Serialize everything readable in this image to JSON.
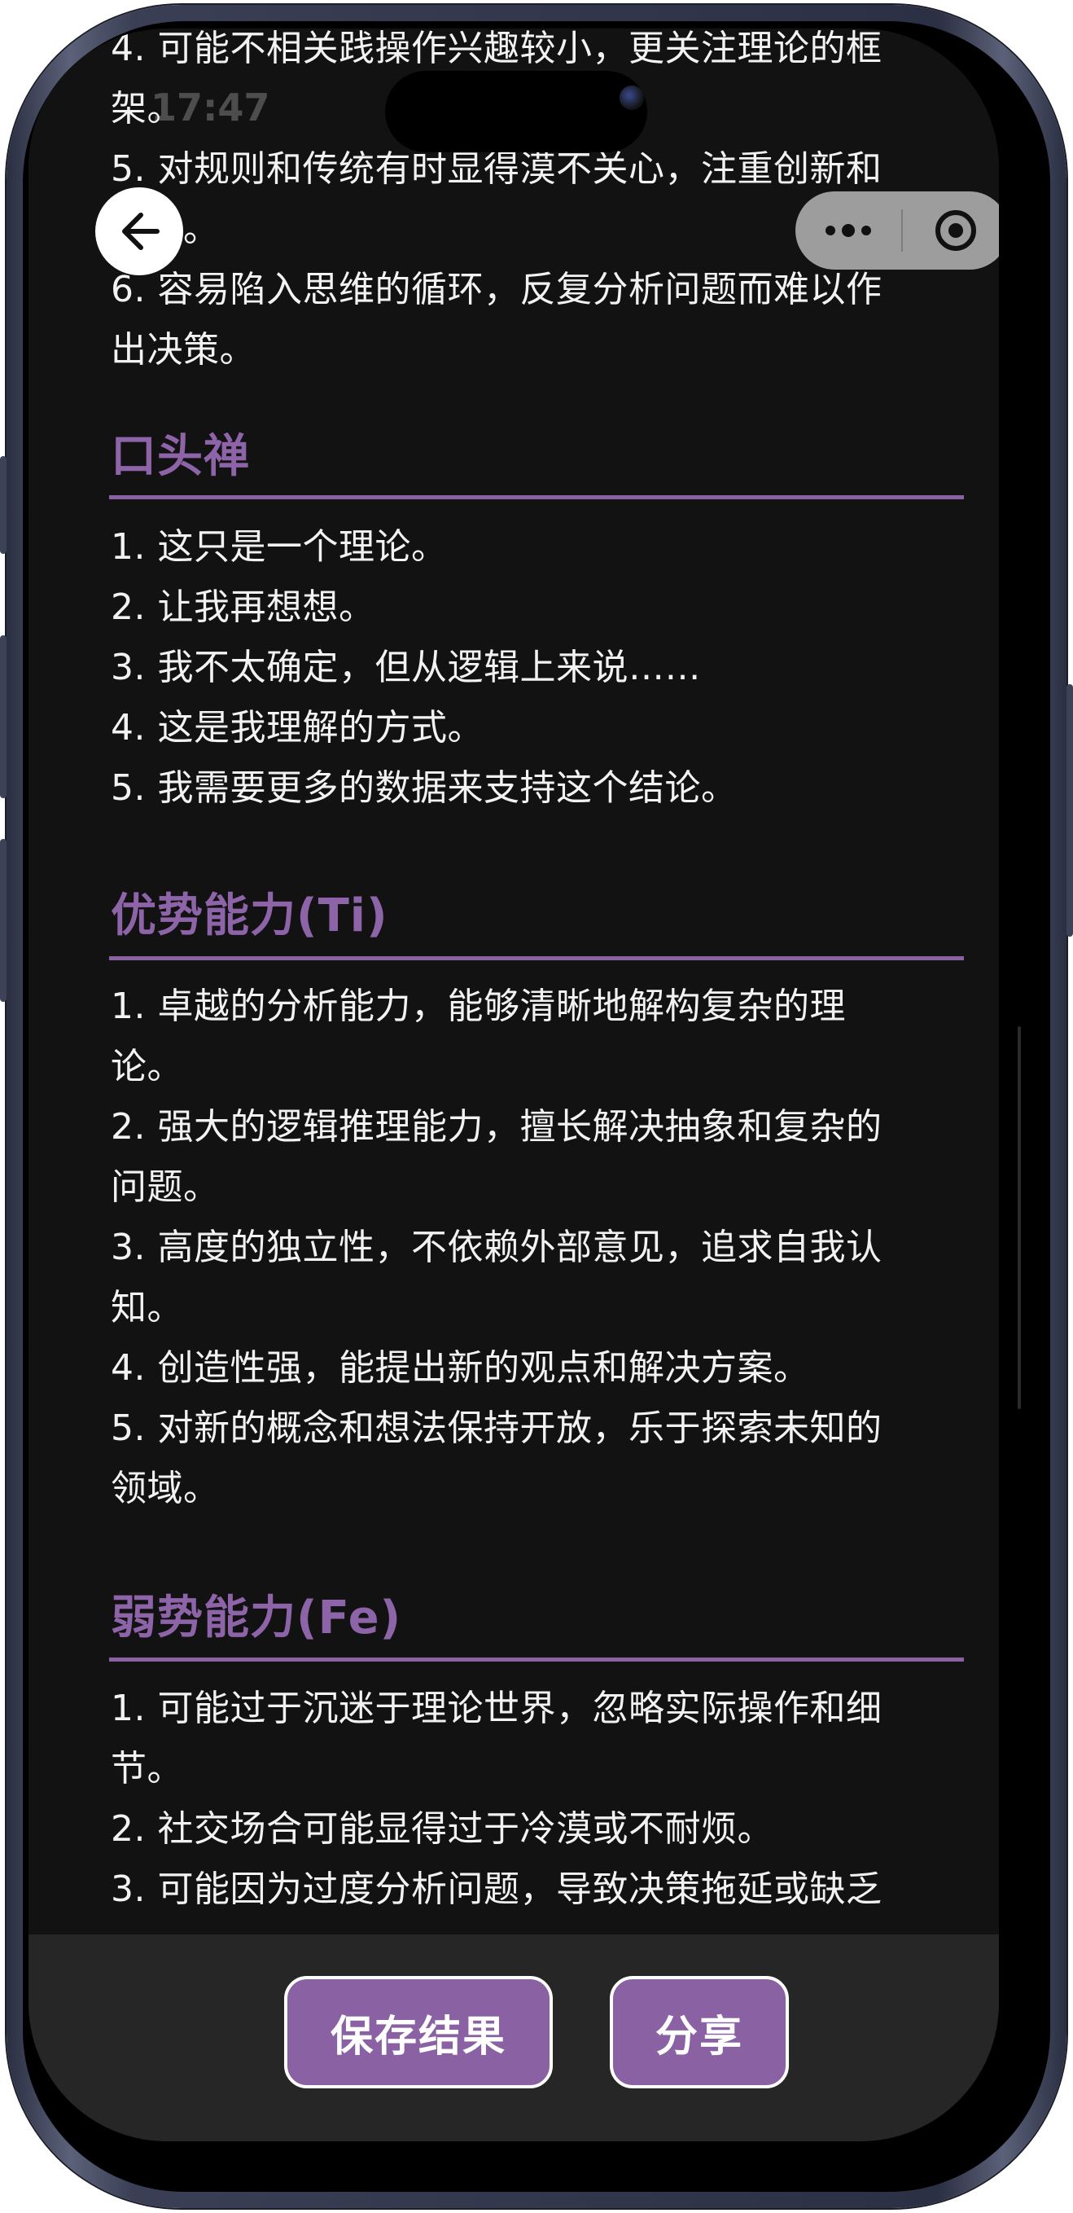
{
  "status": {
    "time": "17:47"
  },
  "top_partial_lines": [
    "4. 可能不相关践操作兴趣较小，更关注理论的框",
    "架。",
    "5. 对规则和传统有时显得漠不关心，注重创新和",
    "自由。",
    "6. 容易陷入思维的循环，反复分析问题而难以作",
    "出决策。"
  ],
  "sections": [
    {
      "title": "口头禅",
      "lines": [
        "1. 这只是一个理论。",
        "2. 让我再想想。",
        "3. 我不太确定，但从逻辑上来说……",
        "4. 这是我理解的方式。",
        "5. 我需要更多的数据来支持这个结论。"
      ]
    },
    {
      "title": "优势能力(Ti)",
      "lines": [
        "1. 卓越的分析能力，能够清晰地解构复杂的理",
        "论。",
        "2. 强大的逻辑推理能力，擅长解决抽象和复杂的",
        "问题。",
        "3. 高度的独立性，不依赖外部意见，追求自我认",
        "知。",
        "4. 创造性强，能提出新的观点和解决方案。",
        "5. 对新的概念和想法保持开放，乐于探索未知的",
        "领域。"
      ]
    },
    {
      "title": "弱势能力(Fe)",
      "lines": [
        "1. 可能过于沉迷于理论世界，忽略实际操作和细",
        "节。",
        "2. 社交场合可能显得过于冷漠或不耐烦。",
        "3. 可能因为过度分析问题，导致决策拖延或缺乏"
      ]
    }
  ],
  "buttons": {
    "save": "保存结果",
    "share": "分享"
  },
  "icons": {
    "back": "arrow-left-icon",
    "more": "more-dots-icon",
    "close": "target-circle-icon"
  },
  "colors": {
    "accent": "#8a62a4",
    "background": "#121212",
    "bottom_bar": "#262626"
  }
}
